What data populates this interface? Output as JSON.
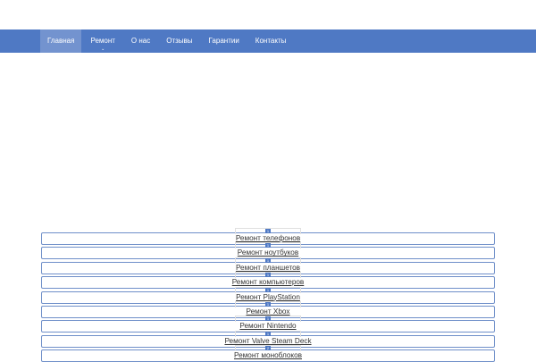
{
  "nav": {
    "items": [
      {
        "label": "Главная"
      },
      {
        "label": "Ремонт",
        "has_dropdown": true
      },
      {
        "label": "О нас"
      },
      {
        "label": "Отзывы"
      },
      {
        "label": "Гарантии"
      },
      {
        "label": "Контакты"
      }
    ],
    "active_index": 0,
    "caret": "⌄"
  },
  "services": [
    {
      "label": "Ремонт телефонов",
      "badge": "1"
    },
    {
      "label": "Ремонт ноутбуков",
      "badge": "1"
    },
    {
      "label": "Ремонт планшетов",
      "badge": "1"
    },
    {
      "label": "Ремонт компьютеров",
      "badge": "1"
    },
    {
      "label": "Ремонт PlayStation",
      "badge": "1"
    },
    {
      "label": "Ремонт Xbox",
      "badge": "1"
    },
    {
      "label": "Ремонт Nintendo",
      "badge": "1"
    },
    {
      "label": "Ремонт Valve Steam Deck",
      "badge": "1"
    },
    {
      "label": "Ремонт моноблоков",
      "badge": "2"
    }
  ],
  "colors": {
    "nav_bg": "#4f79c4",
    "nav_active": "#7393cf",
    "card_border": "#6f8fc9"
  }
}
